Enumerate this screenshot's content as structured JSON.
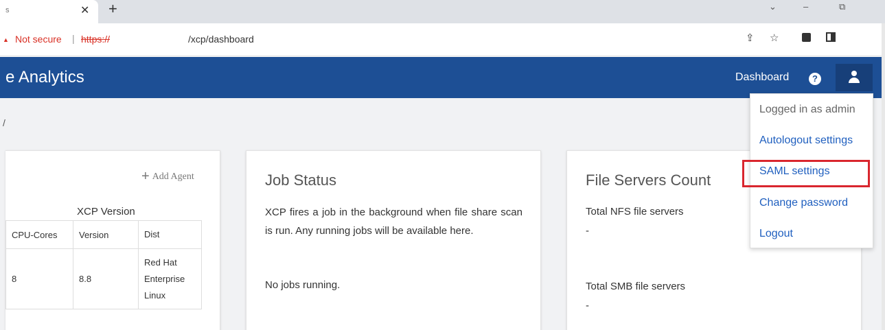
{
  "browser": {
    "tab_title": "s",
    "tab_close": "✕",
    "new_tab": "+",
    "window_controls": {
      "minimize": "–",
      "restore": "⧉",
      "dropdown": "⌄"
    },
    "address": {
      "warning_glyph": "▲",
      "not_secure": "Not secure",
      "separator": "|",
      "scheme": "https://",
      "path": "/xcp/dashboard"
    }
  },
  "header": {
    "title": "e Analytics",
    "nav_dashboard": "Dashboard",
    "help_glyph": "?"
  },
  "breadcrumb": "/",
  "agents_card": {
    "add_agent": "Add Agent",
    "xcp_version_heading": "XCP Version",
    "columns": [
      "CPU-Cores",
      "Version",
      "Dist"
    ],
    "rows": [
      {
        "cpu_cores": "8",
        "version": "8.8",
        "dist": "Red Hat Enterprise Linux"
      }
    ]
  },
  "job_status": {
    "title": "Job Status",
    "description": "XCP fires a job in the background when file share scan is run. Any running jobs will be available here.",
    "status": "No jobs running."
  },
  "file_servers": {
    "title": "File Servers Count",
    "nfs_label": "Total NFS file servers",
    "nfs_value": "-",
    "smb_label": "Total SMB file servers",
    "smb_value": "-"
  },
  "user_menu": {
    "logged_in": "Logged in as admin",
    "items": [
      "Autologout settings",
      "SAML settings",
      "Change password",
      "Logout"
    ]
  },
  "colors": {
    "header_bg": "#1d4f95",
    "link": "#1f5fbf",
    "highlight": "#d9262e",
    "not_secure": "#d93025"
  }
}
